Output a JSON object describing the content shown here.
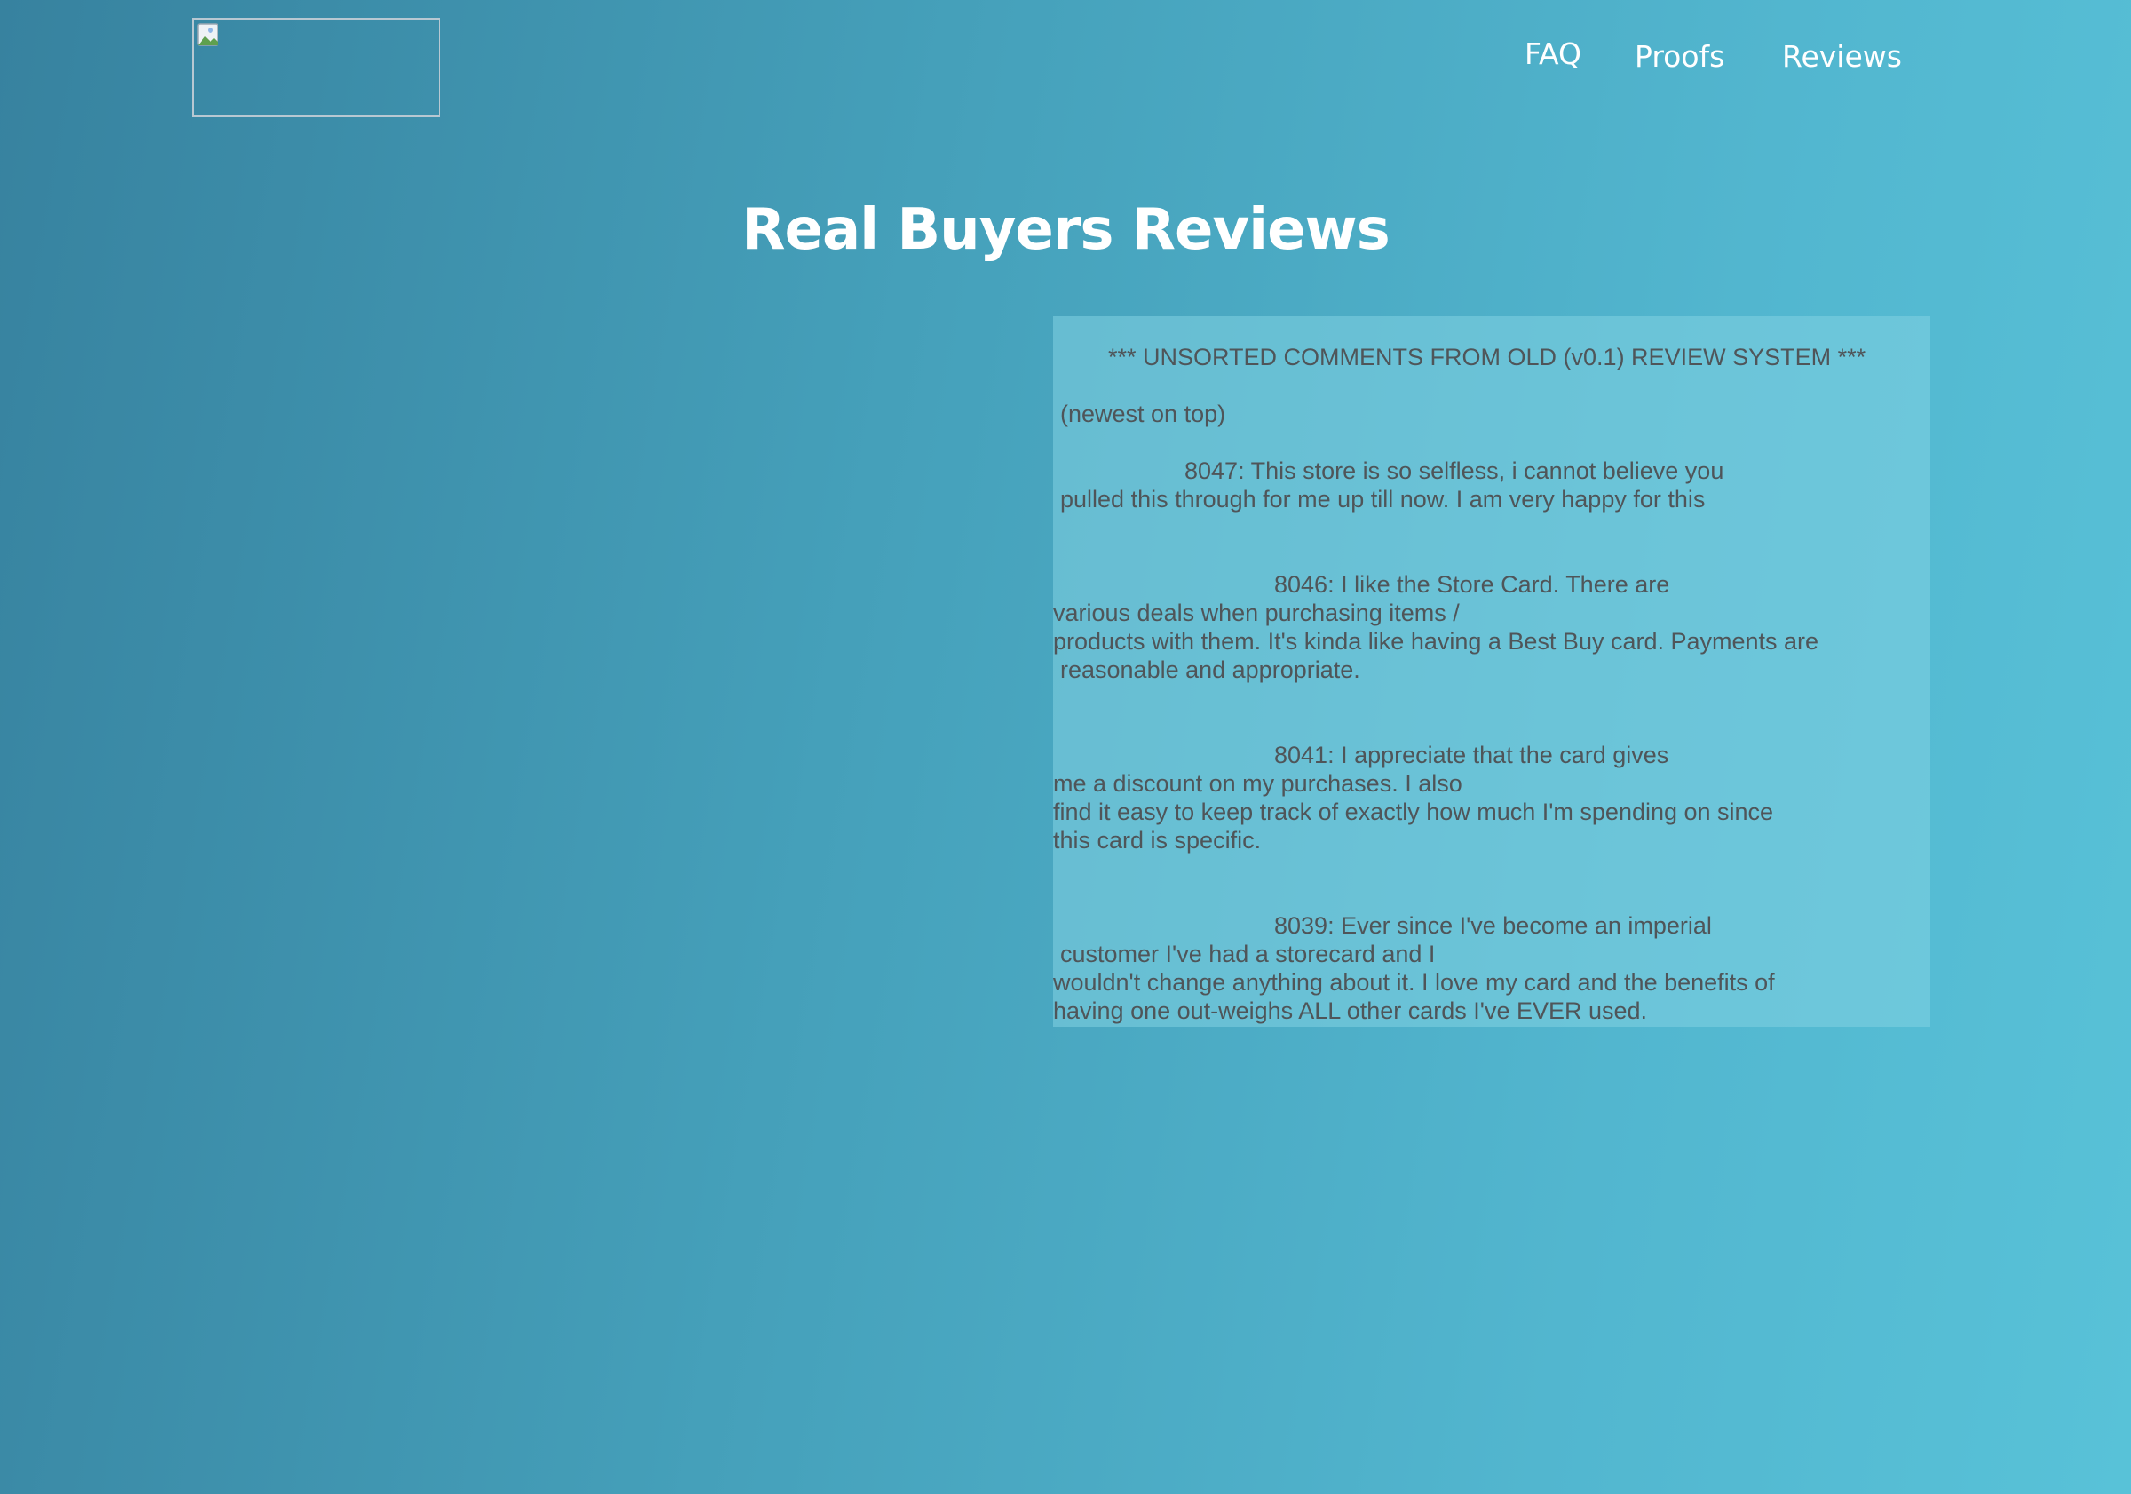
{
  "logo": {
    "alt": ""
  },
  "nav": {
    "faq": "FAQ",
    "proofs": "Proofs",
    "reviews": "Reviews"
  },
  "page": {
    "title": "Real Buyers Reviews"
  },
  "reviews_box": {
    "header": "*** UNSORTED COMMENTS FROM OLD (v0.1) REVIEW SYSTEM ***",
    "subheader": "(newest on top)",
    "reviews": [
      {
        "lines": [
          "8047: This store is so selfless, i cannot believe you",
          "pulled this through for me up till now. I am very happy for this"
        ]
      },
      {
        "lines": [
          "8046: I like the Store Card. There are",
          "various deals when purchasing items /",
          "products with them. It's kinda like having a Best Buy card. Payments are",
          "reasonable and appropriate."
        ]
      },
      {
        "lines": [
          "8041: I appreciate that the card gives",
          "me a discount on my purchases. I also",
          "find it easy to keep track of exactly how much I'm spending on since",
          "this card is specific."
        ]
      },
      {
        "lines": [
          "8039: Ever since I've become an imperial",
          "customer I've had a storecard and I",
          "wouldn't change anything about it. I love my card and the benefits of",
          "having one out-weighs ALL other cards I've EVER used."
        ]
      }
    ]
  }
}
